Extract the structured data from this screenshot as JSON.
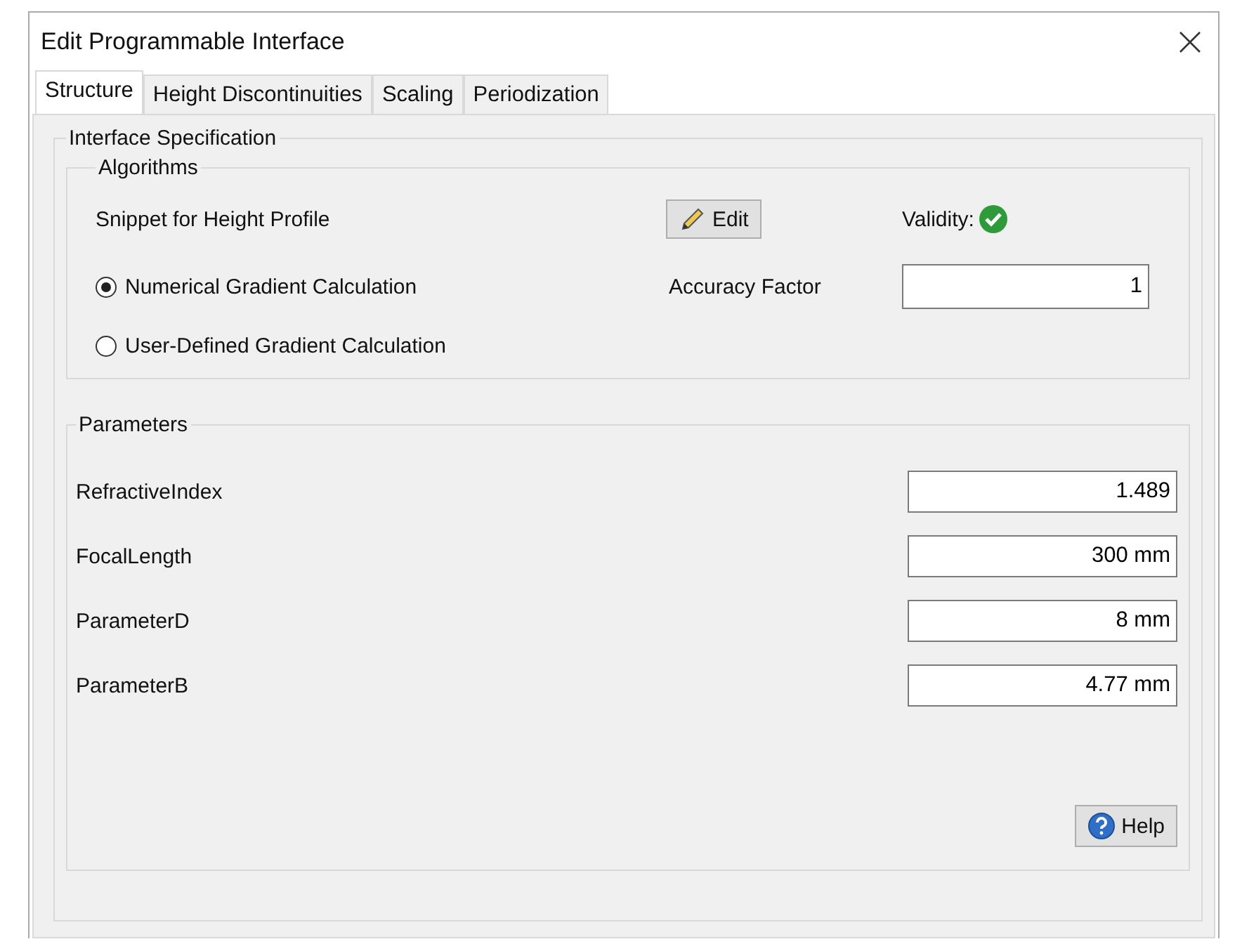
{
  "window": {
    "title": "Edit Programmable Interface"
  },
  "tabs": [
    {
      "label": "Structure",
      "selected": true
    },
    {
      "label": "Height Discontinuities",
      "selected": false
    },
    {
      "label": "Scaling",
      "selected": false
    },
    {
      "label": "Periodization",
      "selected": false
    }
  ],
  "interface_specification": {
    "title": "Interface Specification",
    "algorithms": {
      "title": "Algorithms",
      "snippet_label": "Snippet for Height Profile",
      "edit_button": "Edit",
      "validity_label": "Validity:",
      "valid": true,
      "gradient_options": [
        {
          "label": "Numerical Gradient Calculation",
          "selected": true
        },
        {
          "label": "User-Defined Gradient Calculation",
          "selected": false
        }
      ],
      "accuracy_label": "Accuracy Factor",
      "accuracy_value": "1"
    },
    "parameters": {
      "title": "Parameters",
      "rows": [
        {
          "name": "RefractiveIndex",
          "value": "1.489"
        },
        {
          "name": "FocalLength",
          "value": "300 mm"
        },
        {
          "name": "ParameterD",
          "value": "8 mm"
        },
        {
          "name": "ParameterB",
          "value": "4.77 mm"
        }
      ]
    },
    "help_button": "Help"
  }
}
